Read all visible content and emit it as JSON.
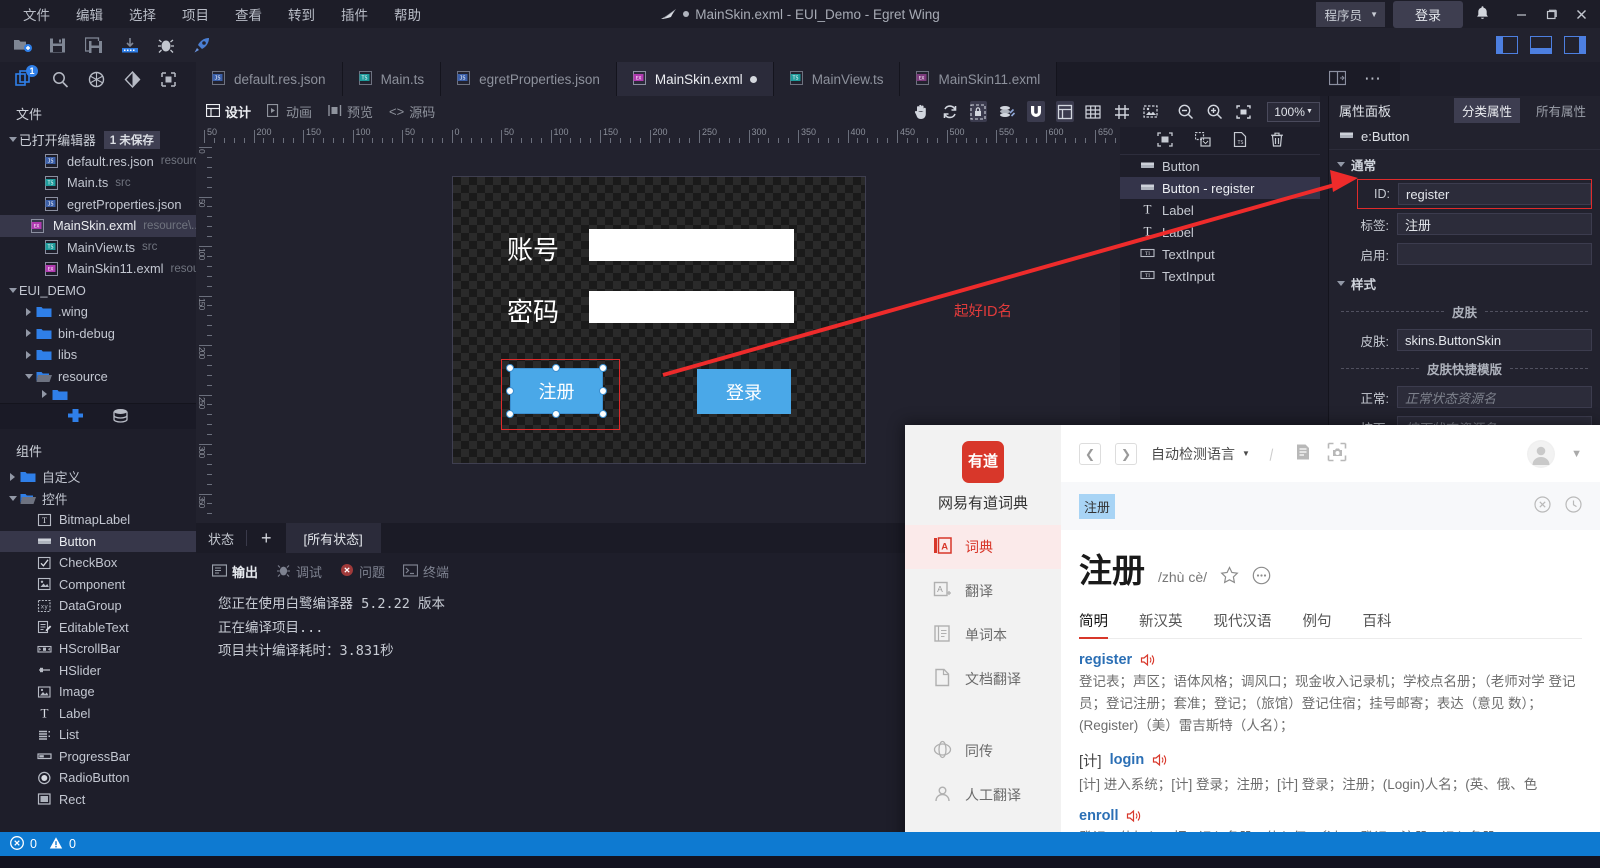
{
  "titlebar": {
    "menus": [
      "文件",
      "编辑",
      "选择",
      "项目",
      "查看",
      "转到",
      "插件",
      "帮助"
    ],
    "window_title": "MainSkin.exml - EUI_Demo - Egret Wing",
    "role_label": "程序员",
    "login_label": "登录"
  },
  "sidebar": {
    "files_title": "文件",
    "open_editors_label": "已打开编辑器",
    "unsaved_badge": "1 未保存",
    "open_editors": [
      {
        "name": "default.res.json",
        "meta": "resource",
        "icon": "json-file-icon",
        "modified": false
      },
      {
        "name": "Main.ts",
        "meta": "src",
        "icon": "ts-file-icon",
        "modified": false
      },
      {
        "name": "egretProperties.json",
        "meta": "",
        "icon": "json-file-icon",
        "modified": false
      },
      {
        "name": "MainSkin.exml",
        "meta": "resource\\...",
        "icon": "exml-file-icon",
        "modified": true
      },
      {
        "name": "MainView.ts",
        "meta": "src",
        "icon": "ts-file-icon",
        "modified": false
      },
      {
        "name": "MainSkin11.exml",
        "meta": "resour...",
        "icon": "exml-file-icon",
        "modified": false
      }
    ],
    "project_name": "EUI_DEMO",
    "project_tree": [
      {
        "name": ".wing",
        "expanded": false
      },
      {
        "name": "bin-debug",
        "expanded": false
      },
      {
        "name": "libs",
        "expanded": false
      },
      {
        "name": "resource",
        "expanded": true
      }
    ],
    "components_title": "组件",
    "component_groups": [
      {
        "name": "自定义",
        "expanded": false
      },
      {
        "name": "控件",
        "expanded": true
      }
    ],
    "components": [
      {
        "name": "BitmapLabel",
        "icon": "bitmaplabel-icon"
      },
      {
        "name": "Button",
        "icon": "button-icon",
        "selected": true
      },
      {
        "name": "CheckBox",
        "icon": "checkbox-icon"
      },
      {
        "name": "Component",
        "icon": "component-icon"
      },
      {
        "name": "DataGroup",
        "icon": "datagroup-icon"
      },
      {
        "name": "EditableText",
        "icon": "editabletext-icon"
      },
      {
        "name": "HScrollBar",
        "icon": "hscrollbar-icon"
      },
      {
        "name": "HSlider",
        "icon": "hslider-icon"
      },
      {
        "name": "Image",
        "icon": "image-icon"
      },
      {
        "name": "Label",
        "icon": "label-icon"
      },
      {
        "name": "List",
        "icon": "list-icon"
      },
      {
        "name": "ProgressBar",
        "icon": "progressbar-icon"
      },
      {
        "name": "RadioButton",
        "icon": "radiobutton-icon"
      },
      {
        "name": "Rect",
        "icon": "rect-icon"
      }
    ]
  },
  "editor": {
    "tabs": [
      {
        "label": "default.res.json",
        "icon": "json-file-icon",
        "active": false,
        "modified": false
      },
      {
        "label": "Main.ts",
        "icon": "ts-file-icon",
        "active": false,
        "modified": false
      },
      {
        "label": "egretProperties.json",
        "icon": "json-file-icon",
        "active": false,
        "modified": false
      },
      {
        "label": "MainSkin.exml",
        "icon": "exml-file-icon",
        "active": true,
        "modified": true
      },
      {
        "label": "MainView.ts",
        "icon": "ts-file-icon",
        "active": false,
        "modified": false
      },
      {
        "label": "MainSkin11.exml",
        "icon": "exml-file-icon",
        "active": false,
        "modified": false
      }
    ],
    "modes": [
      {
        "label": "设计",
        "active": true
      },
      {
        "label": "动画",
        "active": false
      },
      {
        "label": "预览",
        "active": false
      },
      {
        "label": "源码",
        "active": false
      }
    ],
    "zoom_level": "100%"
  },
  "canvas": {
    "label_account": "账号",
    "label_password": "密码",
    "button_register": "注册",
    "button_login": "登录",
    "annotation": "起好ID名",
    "ruler_h_labels": [
      "50",
      "200",
      "150",
      "100",
      "50",
      "0",
      "50",
      "100",
      "150",
      "200",
      "250",
      "300",
      "350",
      "400",
      "450",
      "500",
      "550",
      "600",
      "650"
    ],
    "ruler_v_labels": [
      "0",
      "50",
      "100",
      "150",
      "200",
      "250",
      "300",
      "350"
    ]
  },
  "state_panel": {
    "state_label": "状态",
    "add_label": "+",
    "all_states_tab": "[所有状态]"
  },
  "output": {
    "tabs": [
      {
        "label": "输出",
        "icon": "output-icon",
        "active": true
      },
      {
        "label": "调试",
        "icon": "bug-icon",
        "active": false
      },
      {
        "label": "问题",
        "icon": "problem-icon",
        "active": false
      },
      {
        "label": "终端",
        "icon": "terminal-icon",
        "active": false
      }
    ],
    "lines": [
      "您正在使用白鹭编译器 5.2.22 版本",
      "正在编译项目...",
      "项目共计编译耗时：3.831秒"
    ]
  },
  "outline": {
    "items": [
      {
        "label": "Button",
        "icon": "button-icon",
        "selected": false
      },
      {
        "label": "Button - register",
        "icon": "button-icon",
        "selected": true
      },
      {
        "label": "Label",
        "icon": "label-icon",
        "selected": false
      },
      {
        "label": "Label",
        "icon": "label-icon",
        "selected": false
      },
      {
        "label": "TextInput",
        "icon": "textinput-icon",
        "selected": false
      },
      {
        "label": "TextInput",
        "icon": "textinput-icon",
        "selected": false
      }
    ]
  },
  "properties": {
    "panel_title": "属性面板",
    "tab_category": "分类属性",
    "tab_all": "所有属性",
    "object_type": "e:Button",
    "group_general": "通常",
    "group_style": "样式",
    "label_id": "ID:",
    "value_id": "register",
    "label_tag": "标签:",
    "value_tag": "注册",
    "label_enable": "启用:",
    "value_enable": "",
    "divider_skin": "皮肤",
    "label_skin": "皮肤:",
    "value_skin": "skins.ButtonSkin",
    "divider_skin_template": "皮肤快捷模版",
    "label_normal": "正常:",
    "placeholder_normal": "正常状态资源名",
    "label_pressed": "按下:",
    "placeholder_pressed": "按下状态资源名"
  },
  "statusbar": {
    "error_count": "0",
    "warning_count": "0"
  },
  "youdao": {
    "brand": "网易有道词典",
    "logo_text": "有道",
    "nav": [
      {
        "label": "词典",
        "icon": "dictionary-icon",
        "active": true
      },
      {
        "label": "翻译",
        "icon": "translate-icon",
        "active": false
      },
      {
        "label": "单词本",
        "icon": "wordbook-icon",
        "active": false
      },
      {
        "label": "文档翻译",
        "icon": "document-translate-icon",
        "active": false
      },
      {
        "label": "同传",
        "icon": "simultaneous-icon",
        "active": false
      },
      {
        "label": "人工翻译",
        "icon": "human-translate-icon",
        "active": false
      }
    ],
    "lang_selector": "自动检测语言",
    "search_query": "注册",
    "word": "注册",
    "pinyin": "/zhù cè/",
    "tabs": [
      {
        "label": "简明",
        "active": true
      },
      {
        "label": "新汉英",
        "active": false
      },
      {
        "label": "现代汉语",
        "active": false
      },
      {
        "label": "例句",
        "active": false
      },
      {
        "label": "百科",
        "active": false
      }
    ],
    "entries": [
      {
        "tag": "",
        "term": "register",
        "definition": "登记表；声区；语体风格；调风口；现金收入记录机；学校点名册；（老师对学 登记员；登记注册；套准；登记；（旅馆）登记住宿；挂号邮寄；表达（意见 数）；(Register)（美）雷吉斯特（人名）；"
      },
      {
        "tag": "[计]",
        "term": "login",
        "definition": "[计] 进入系统；[计] 登录；注册；[计] 登录；注册；(Login)人名；(英、俄、色"
      },
      {
        "tag": "",
        "term": "enroll",
        "definition": "登记；使加入；把...记入名册；使入伍；参加；登记；注册；记入名册；"
      }
    ]
  }
}
